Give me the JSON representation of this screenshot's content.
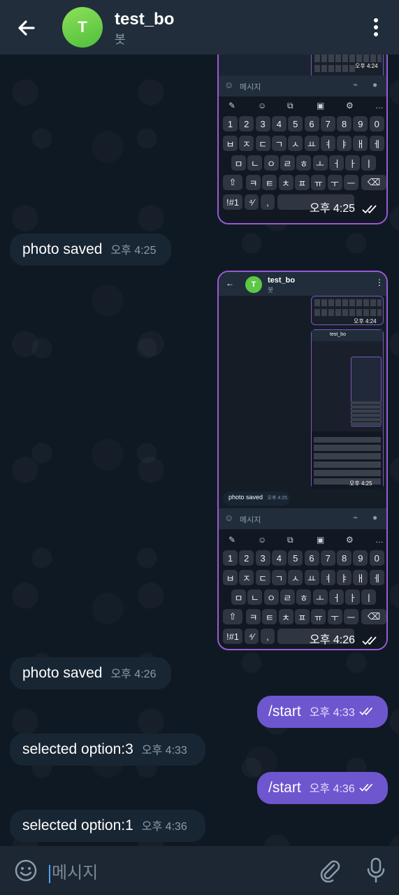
{
  "header": {
    "back_icon": "arrow-left-icon",
    "avatar_letter": "T",
    "title": "test_bo",
    "subtitle": "봇",
    "menu_icon": "more-vertical-icon"
  },
  "messages": [
    {
      "dir": "in",
      "text": "photo saved",
      "time": "오후 4:25"
    },
    {
      "dir": "in",
      "text": "photo saved",
      "time": "오후 4:26"
    },
    {
      "dir": "out",
      "text": "/start",
      "time": "오후 4:33"
    },
    {
      "dir": "in",
      "text": "selected option:3",
      "time": "오후 4:33"
    },
    {
      "dir": "out",
      "text": "/start",
      "time": "오후 4:36"
    },
    {
      "dir": "in",
      "text": "selected option:1",
      "time": "오후 4:36"
    }
  ],
  "photo1": {
    "time": "오후 4:25",
    "mini_input_placeholder": "메시지",
    "mini_time": "오후 4:24",
    "mini_keyboard_time": "오후 4:24"
  },
  "photo2": {
    "time": "오후 4:26",
    "header_title": "test_bo",
    "header_subtitle": "봇",
    "avatar_letter": "T",
    "inner_mini_time": "오후 4:24",
    "inner_msg": "photo saved",
    "inner_msg_time": "오후 4:25",
    "inner_input_placeholder": "메시지",
    "nested_header_title": "test_bo",
    "nested_time": "오후 4:25"
  },
  "keyboard": {
    "row_numbers": [
      "1",
      "2",
      "3",
      "4",
      "5",
      "6",
      "7",
      "8",
      "9",
      "0"
    ],
    "row1": [
      "ㅂ",
      "ㅈ",
      "ㄷ",
      "ㄱ",
      "ㅅ",
      "ㅛ",
      "ㅕ",
      "ㅑ",
      "ㅐ",
      "ㅔ"
    ],
    "row2": [
      "ㅁ",
      "ㄴ",
      "ㅇ",
      "ㄹ",
      "ㅎ",
      "ㅗ",
      "ㅓ",
      "ㅏ",
      "ㅣ"
    ],
    "row3": [
      "ㅋ",
      "ㅌ",
      "ㅊ",
      "ㅍ",
      "ㅠ",
      "ㅜ",
      "ㅡ"
    ],
    "sym_key": "!#1",
    "comma": ","
  },
  "inputbar": {
    "placeholder": "메시지",
    "emoji_icon": "emoji-icon",
    "attach_icon": "paperclip-icon",
    "mic_icon": "microphone-icon"
  },
  "colors": {
    "header": "#212d3b",
    "incoming": "#182533",
    "outgoing": "#6e56cf",
    "avatar": "#5cc846",
    "photo_border": "#9b59d6"
  }
}
